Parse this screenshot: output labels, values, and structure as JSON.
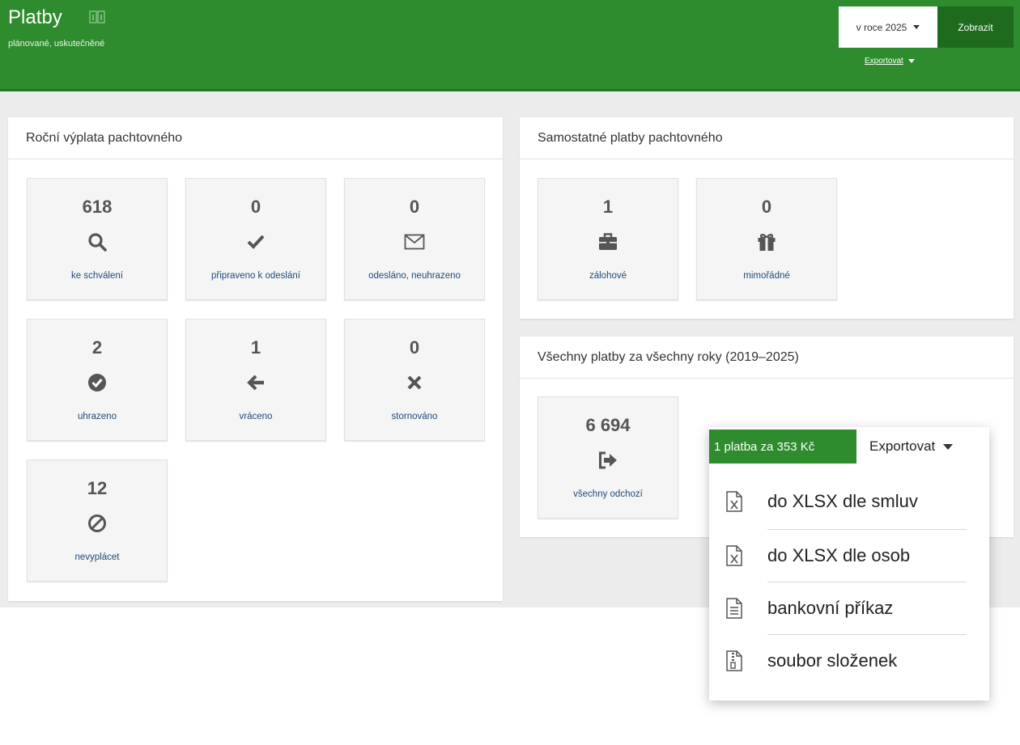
{
  "header": {
    "title": "Platby",
    "subtitle": "plánované, uskutečněné",
    "year_select": "v roce 2025",
    "show_button": "Zobrazit",
    "export_link": "Exportovat",
    "accent": "#2e8b2e"
  },
  "annual": {
    "title": "Roční výplata pachtovného",
    "tiles": [
      {
        "value": "618",
        "label": "ke schválení",
        "icon": "search-icon"
      },
      {
        "value": "0",
        "label": "připraveno k odeslání",
        "icon": "check-icon"
      },
      {
        "value": "0",
        "label": "odesláno, neuhrazeno",
        "icon": "envelope-icon"
      },
      {
        "value": "2",
        "label": "uhrazeno",
        "icon": "check-circle-icon"
      },
      {
        "value": "1",
        "label": "vráceno",
        "icon": "arrow-left-icon"
      },
      {
        "value": "0",
        "label": "stornováno",
        "icon": "times-icon"
      },
      {
        "value": "12",
        "label": "nevyplácet",
        "icon": "ban-icon"
      }
    ]
  },
  "separate": {
    "title": "Samostatné platby pachtovného",
    "tiles": [
      {
        "value": "1",
        "label": "zálohové",
        "icon": "briefcase-icon"
      },
      {
        "value": "0",
        "label": "mimořádné",
        "icon": "gift-icon"
      }
    ]
  },
  "all": {
    "title": "Všechny platby za všechny roky (2019–2025)",
    "tile": {
      "value": "6 694",
      "label": "všechny odchozí",
      "icon": "sign-out-icon"
    }
  },
  "dropdown": {
    "badge": "1 platba za 353 Kč",
    "export_label": "Exportovat",
    "items": [
      {
        "label": "do XLSX dle smluv",
        "icon": "excel-file-icon"
      },
      {
        "label": "do XLSX dle osob",
        "icon": "excel-file-icon"
      },
      {
        "label": "bankovní příkaz",
        "icon": "text-file-icon"
      },
      {
        "label": "soubor složenek",
        "icon": "archive-file-icon"
      }
    ]
  }
}
